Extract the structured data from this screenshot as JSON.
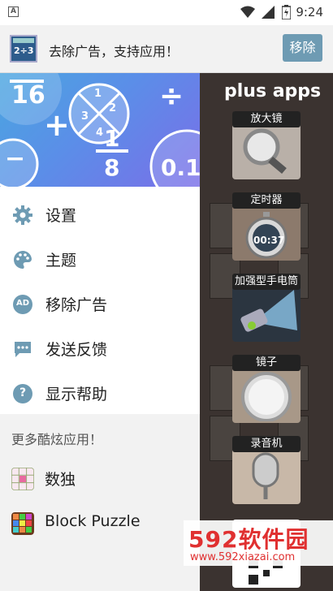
{
  "status_bar": {
    "time": "9:24",
    "left_icon": "A"
  },
  "ad_bar": {
    "text": "去除广告，支持应用！",
    "remove_label": "移除"
  },
  "plus_apps": {
    "title": "plus apps",
    "apps": [
      {
        "label": "放大镜",
        "icon": "magnifier-icon"
      },
      {
        "label": "定时器",
        "icon": "stopwatch-icon",
        "display": "00:37"
      },
      {
        "label": "加强型手电筒",
        "icon": "flashlight-icon"
      },
      {
        "label": "镜子",
        "icon": "mirror-icon"
      },
      {
        "label": "录音机",
        "icon": "microphone-icon"
      }
    ]
  },
  "drawer": {
    "header_glyphs": {
      "fraction_top": "16",
      "plus": "+",
      "one": "1",
      "eight": "8",
      "decimal": "0.1",
      "minus": "−",
      "divide": "÷",
      "circle_digits": [
        "1",
        "2",
        "3",
        "4"
      ]
    },
    "menu": [
      {
        "label": "设置",
        "icon": "gear-icon"
      },
      {
        "label": "主题",
        "icon": "palette-icon"
      },
      {
        "label": "移除广告",
        "icon": "ad-icon",
        "icon_text": "AD"
      },
      {
        "label": "发送反馈",
        "icon": "chat-icon"
      },
      {
        "label": "显示帮助",
        "icon": "help-icon",
        "icon_text": "?"
      }
    ],
    "more_title": "更多酷炫应用！",
    "more_apps": [
      {
        "label": "数独",
        "icon": "sudoku-icon"
      },
      {
        "label": "Block Puzzle",
        "icon": "block-puzzle-icon"
      }
    ]
  },
  "watermark": {
    "big": "592软件园",
    "small": "www.592xiazai.com"
  },
  "colors": {
    "accent": "#6e9bb3",
    "drawer_bg": "#ffffff",
    "more_bg": "#f2f2f2"
  }
}
